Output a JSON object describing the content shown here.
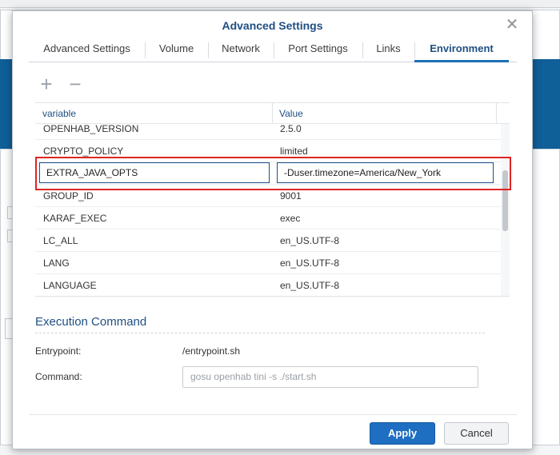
{
  "dialog": {
    "title": "Advanced Settings",
    "close_icon": "close-icon"
  },
  "tabs": [
    {
      "label": "Advanced Settings",
      "active": false
    },
    {
      "label": "Volume",
      "active": false
    },
    {
      "label": "Network",
      "active": false
    },
    {
      "label": "Port Settings",
      "active": false
    },
    {
      "label": "Links",
      "active": false
    },
    {
      "label": "Environment",
      "active": true
    }
  ],
  "toolbar": {
    "add_icon": "+",
    "remove_icon": "−"
  },
  "env_table": {
    "columns": [
      "variable",
      "Value"
    ],
    "rows": [
      {
        "variable": "OPENHAB_VERSION",
        "value": "2.5.0"
      },
      {
        "variable": "CRYPTO_POLICY",
        "value": "limited"
      },
      {
        "variable": "EXTRA_JAVA_OPTS",
        "value": "-Duser.timezone=America/New_York",
        "editing": true
      },
      {
        "variable": "GROUP_ID",
        "value": "9001"
      },
      {
        "variable": "KARAF_EXEC",
        "value": "exec"
      },
      {
        "variable": "LC_ALL",
        "value": "en_US.UTF-8"
      },
      {
        "variable": "LANG",
        "value": "en_US.UTF-8"
      },
      {
        "variable": "LANGUAGE",
        "value": "en_US.UTF-8"
      }
    ]
  },
  "execution": {
    "title": "Execution Command",
    "entrypoint_label": "Entrypoint:",
    "entrypoint_value": "/entrypoint.sh",
    "command_label": "Command:",
    "command_placeholder": "gosu openhab tini -s ./start.sh"
  },
  "buttons": {
    "apply": "Apply",
    "cancel": "Cancel"
  },
  "colors": {
    "accent": "#1f4f82",
    "primary_button": "#1e6ec2",
    "highlight_border": "#e02424",
    "background_banner": "#0f5f98"
  }
}
